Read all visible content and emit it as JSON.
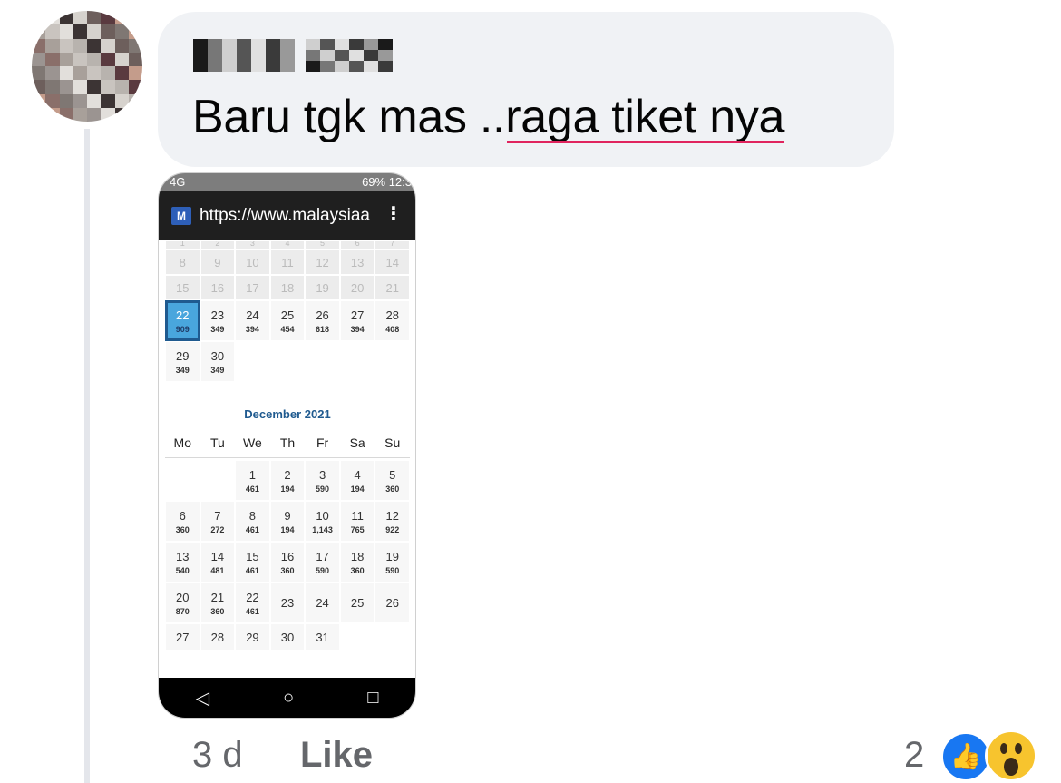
{
  "comment": {
    "text_prefix": "Baru tgk mas ..",
    "text_flagged": "raga tiket nya",
    "time": "3 d",
    "like_label": "Like",
    "reaction_count": "2",
    "reactions": [
      "like-icon",
      "wow-icon"
    ]
  },
  "screenshot": {
    "status_left": "4G",
    "status_right": "69% 12:3",
    "url": "https://www.malaysiaa",
    "menu_glyph": "⋮",
    "nov_past_clip": [
      "1",
      "2",
      "3",
      "4",
      "5",
      "6",
      "7"
    ],
    "nov_past": [
      "8",
      "9",
      "10",
      "11",
      "12",
      "13",
      "14",
      "15",
      "16",
      "17",
      "18",
      "19",
      "20",
      "21"
    ],
    "nov_active": [
      {
        "day": "22",
        "price": "909",
        "selected": true
      },
      {
        "day": "23",
        "price": "349"
      },
      {
        "day": "24",
        "price": "394"
      },
      {
        "day": "25",
        "price": "454"
      },
      {
        "day": "26",
        "price": "618"
      },
      {
        "day": "27",
        "price": "394"
      },
      {
        "day": "28",
        "price": "408"
      },
      {
        "day": "29",
        "price": "349"
      },
      {
        "day": "30",
        "price": "349"
      }
    ],
    "dec_title": "December  2021",
    "weekdays": [
      "Mo",
      "Tu",
      "We",
      "Th",
      "Fr",
      "Sa",
      "Su"
    ],
    "dec_days": [
      {
        "day": "1",
        "price": "461"
      },
      {
        "day": "2",
        "price": "194"
      },
      {
        "day": "3",
        "price": "590"
      },
      {
        "day": "4",
        "price": "194"
      },
      {
        "day": "5",
        "price": "360"
      },
      {
        "day": "6",
        "price": "360"
      },
      {
        "day": "7",
        "price": "272"
      },
      {
        "day": "8",
        "price": "461"
      },
      {
        "day": "9",
        "price": "194"
      },
      {
        "day": "10",
        "price": "1,143"
      },
      {
        "day": "11",
        "price": "765"
      },
      {
        "day": "12",
        "price": "922"
      },
      {
        "day": "13",
        "price": "540"
      },
      {
        "day": "14",
        "price": "481"
      },
      {
        "day": "15",
        "price": "461"
      },
      {
        "day": "16",
        "price": "360"
      },
      {
        "day": "17",
        "price": "590"
      },
      {
        "day": "18",
        "price": "360"
      },
      {
        "day": "19",
        "price": "590"
      },
      {
        "day": "20",
        "price": "870"
      },
      {
        "day": "21",
        "price": "360"
      },
      {
        "day": "22",
        "price": "461"
      },
      {
        "day": "23",
        "price": ""
      },
      {
        "day": "24",
        "price": ""
      },
      {
        "day": "25",
        "price": ""
      },
      {
        "day": "26",
        "price": ""
      },
      {
        "day": "27",
        "price": ""
      },
      {
        "day": "28",
        "price": ""
      },
      {
        "day": "29",
        "price": ""
      },
      {
        "day": "30",
        "price": ""
      },
      {
        "day": "31",
        "price": ""
      }
    ],
    "nav": [
      "◁",
      "○",
      "□"
    ]
  },
  "colors": {
    "bubble": "#f0f2f5",
    "selected_day": "#49a6dd",
    "month_title": "#1f5a8f",
    "like_blue": "#1877f2",
    "spell_underline": "#e0245e"
  }
}
